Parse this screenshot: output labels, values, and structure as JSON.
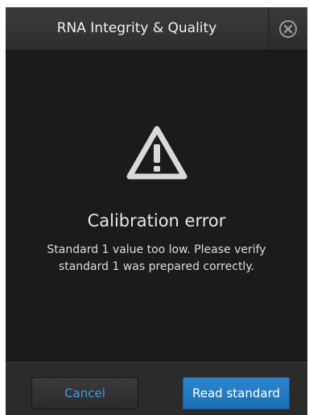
{
  "dialog": {
    "title": "RNA Integrity & Quality",
    "close_icon": "close-circle-icon",
    "alert_icon": "warning-triangle-icon",
    "error_title": "Calibration error",
    "error_message": "Standard 1 value too low. Please verify standard 1 was prepared correctly.",
    "buttons": {
      "cancel_label": "Cancel",
      "read_standard_label": "Read standard"
    }
  },
  "colors": {
    "background": "#1b1b1b",
    "title_bar": "#333333",
    "accent_blue": "#2479c2",
    "link_blue": "#3d9be9",
    "icon": "#d9d9d9"
  }
}
